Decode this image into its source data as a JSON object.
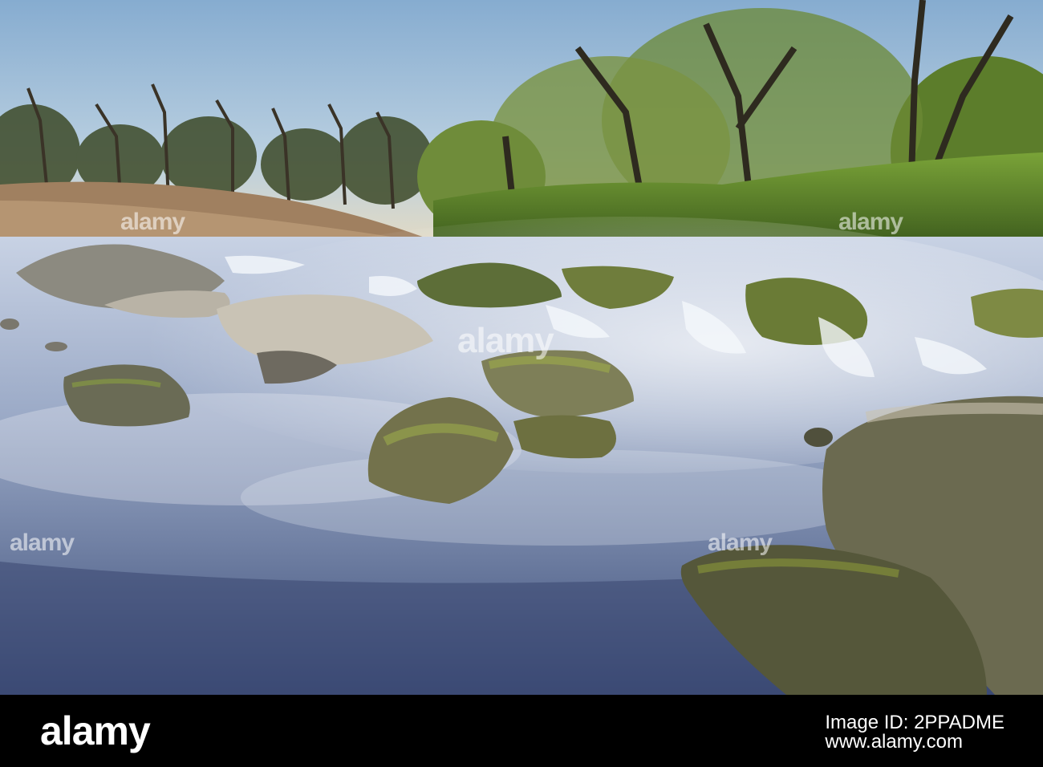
{
  "photo": {
    "subject": "river-rapids-landscape",
    "sky_color": "#9fc2df",
    "water_color": "#6f86a8",
    "foliage_color": "#5a7a2a"
  },
  "watermark": {
    "text": "alamy"
  },
  "footer": {
    "logo": "alamy",
    "image_id_line1": "Image ID: 2PPADME",
    "image_id_line2": "www.alamy.com"
  }
}
